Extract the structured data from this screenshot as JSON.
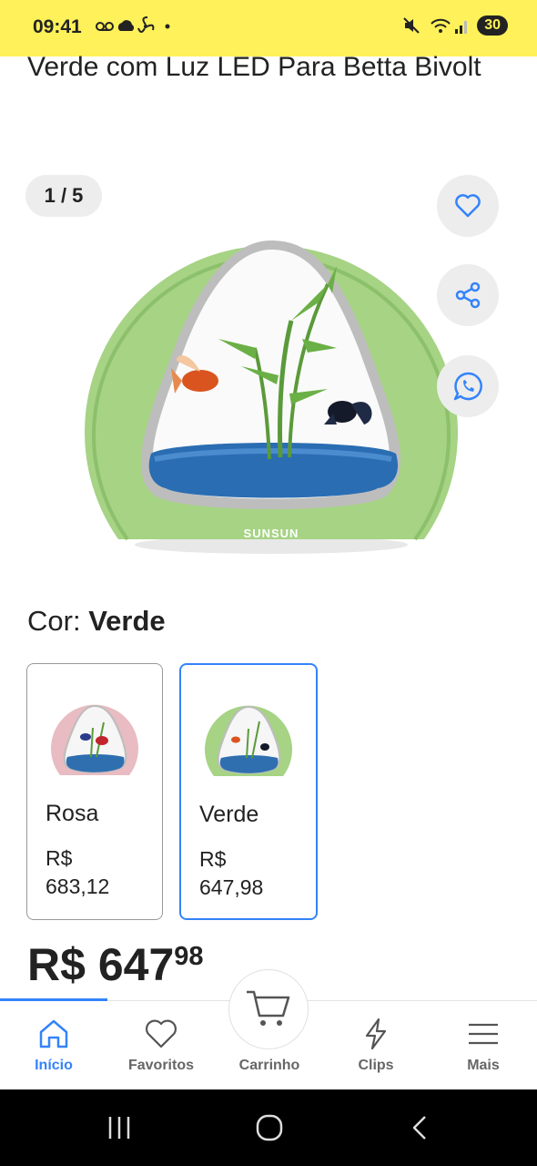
{
  "status_bar": {
    "time": "09:41",
    "battery": "30",
    "bg_color": "#fff159"
  },
  "product": {
    "title": "Verde com Luz LED Para Betta Bivolt",
    "image_counter": "1 / 5",
    "brand_on_image": "SUNSUN",
    "actions": [
      "heart-icon",
      "share-icon",
      "whatsapp-icon"
    ]
  },
  "color_selector": {
    "label": "Cor:",
    "selected": "Verde",
    "variants": [
      {
        "name": "Rosa",
        "currency": "R$",
        "price": "683,12",
        "selected": false
      },
      {
        "name": "Verde",
        "currency": "R$",
        "price": "647,98",
        "selected": true
      }
    ]
  },
  "price": {
    "currency": "R$",
    "integer": "647",
    "cents": "98"
  },
  "bottom_nav": {
    "items": [
      {
        "label": "Início",
        "icon": "home-icon",
        "active": true
      },
      {
        "label": "Favoritos",
        "icon": "heart-icon",
        "active": false
      },
      {
        "label": "Carrinho",
        "icon": "cart-icon",
        "active": false
      },
      {
        "label": "Clips",
        "icon": "lightning-icon",
        "active": false
      },
      {
        "label": "Mais",
        "icon": "menu-icon",
        "active": false
      }
    ],
    "accent_color": "#3483fa"
  },
  "system_nav": [
    "recents-icon",
    "home-circle-icon",
    "back-icon"
  ]
}
